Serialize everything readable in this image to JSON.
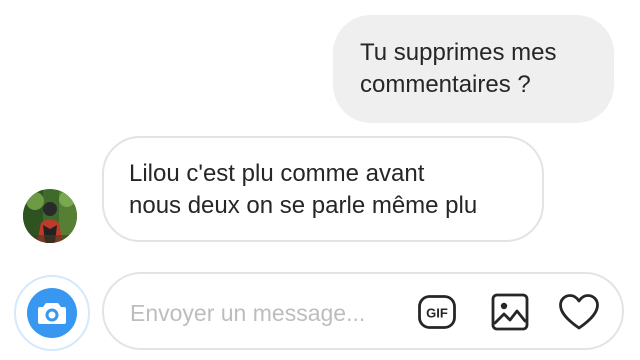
{
  "conversation": {
    "sent_message": {
      "lines": [
        "Tu supprimes mes",
        "commentaires ?"
      ]
    },
    "received_message": {
      "lines": [
        "Lilou c'est plu comme avant",
        "nous deux on se parle même plu"
      ]
    }
  },
  "composer": {
    "placeholder": "Envoyer un message...",
    "value": "",
    "gif_label": "GIF"
  },
  "icons": {
    "camera": "camera-icon",
    "gif": "gif-icon",
    "gallery": "gallery-icon",
    "like": "heart-icon"
  },
  "colors": {
    "accent": "#3897f0",
    "sent_bubble": "#efefef",
    "received_border": "#e3e3e3",
    "text": "#262626",
    "placeholder": "#bdbdbd"
  }
}
